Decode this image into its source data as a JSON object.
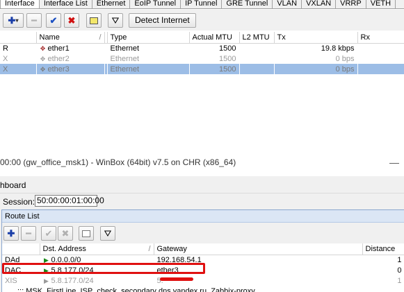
{
  "top_window": {
    "tabs": [
      {
        "label": "Interface",
        "active": true
      },
      {
        "label": "Interface List"
      },
      {
        "label": "Ethernet"
      },
      {
        "label": "EoIP Tunnel"
      },
      {
        "label": "IP Tunnel"
      },
      {
        "label": "GRE Tunnel"
      },
      {
        "label": "VLAN"
      },
      {
        "label": "VXLAN"
      },
      {
        "label": "VRRP"
      },
      {
        "label": "VETH"
      }
    ],
    "toolbar": {
      "add_icon": "plus-icon",
      "detect_internet_label": "Detect Internet"
    },
    "columns": [
      "",
      "Name",
      "",
      "Type",
      "Actual MTU",
      "L2 MTU",
      "Tx",
      "Rx"
    ],
    "rows": [
      {
        "flag": "R",
        "name": "ether1",
        "type": "Ethernet",
        "actual_mtu": "1500",
        "l2_mtu": "",
        "tx": "19.8 kbps",
        "rx": "",
        "state": "normal"
      },
      {
        "flag": "X",
        "name": "ether2",
        "type": "Ethernet",
        "actual_mtu": "1500",
        "l2_mtu": "",
        "tx": "0 bps",
        "rx": "",
        "state": "dim"
      },
      {
        "flag": "X",
        "name": "ether3",
        "type": "Ethernet",
        "actual_mtu": "1500",
        "l2_mtu": "",
        "tx": "0 bps",
        "rx": "",
        "state": "selected"
      }
    ]
  },
  "bottom_window": {
    "title": "00:00 (gw_office_msk1) - WinBox (64bit) v7.5 on CHR (x86_64)",
    "menu_text": "hboard",
    "session_label": "Session:",
    "session_value": "50:00:00:01:00:00",
    "route_list": {
      "title": "Route List",
      "columns": [
        "",
        "Dst. Address",
        "Gateway",
        "Distance"
      ],
      "rows": [
        {
          "flag": "DAd",
          "dst": "0.0.0.0/0",
          "gateway": "192.168.54.1",
          "distance": "1",
          "state": "normal"
        },
        {
          "flag": "DAC",
          "dst": "5.8.177.0/24",
          "gateway": "ether3",
          "distance": "0",
          "state": "normal"
        },
        {
          "flag": "XIS",
          "dst": "5.8.177.0/24",
          "gateway": "5.",
          "distance": "1",
          "state": "dim"
        }
      ],
      "comment_partial": ";;; MSK_FirstLine_ISP_check_secondary dns.yandex.ru, Zabbix-proxy"
    }
  },
  "colors": {
    "highlight": "#e01010",
    "selected_row": "#9cbde6",
    "list_title": "#dbe6f5"
  }
}
